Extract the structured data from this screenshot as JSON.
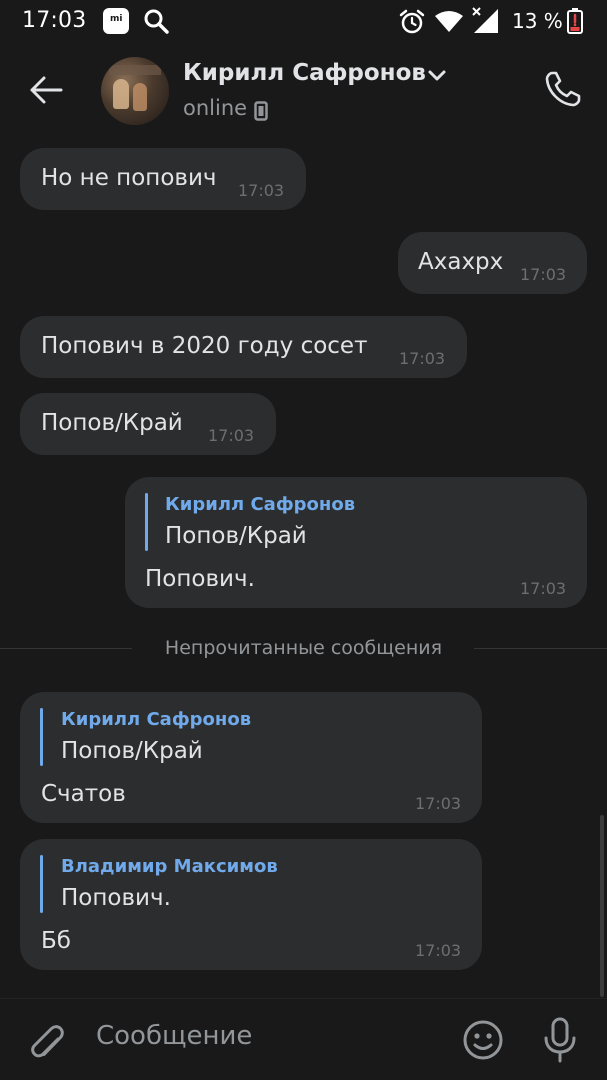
{
  "status_bar": {
    "time": "17:03",
    "mi_label": "mi",
    "battery": "13 %",
    "colors": {
      "battery_low": "#e64646"
    }
  },
  "header": {
    "name": "Кирилл Сафронов",
    "status": "online",
    "icons": {
      "back": "arrow-left-icon",
      "call": "phone-icon",
      "chevron": "chevron-down-icon",
      "device": "mobile-device-icon"
    }
  },
  "messages": [
    {
      "direction": "incoming",
      "text": "Но не попович",
      "time": "17:03"
    },
    {
      "direction": "outgoing",
      "text": "Ахахрх",
      "time": "17:03"
    },
    {
      "direction": "incoming",
      "text": "Попович в 2020 году сосет",
      "time": "17:03"
    },
    {
      "direction": "incoming",
      "text": "Попов/Край",
      "time": "17:03"
    },
    {
      "direction": "outgoing",
      "reply": {
        "author": "Кирилл Сафронов",
        "text": "Попов/Край"
      },
      "text": "Попович.",
      "time": "17:03"
    },
    {
      "direction": "incoming",
      "reply": {
        "author": "Кирилл Сафронов",
        "text": "Попов/Край"
      },
      "text": "Счатов",
      "time": "17:03"
    },
    {
      "direction": "incoming",
      "reply": {
        "author": "Владимир Максимов",
        "text": "Попович."
      },
      "text": "Бб",
      "time": "17:03"
    }
  ],
  "unread_divider": "Непрочитанные сообщения",
  "composer": {
    "placeholder": "Сообщение",
    "icons": {
      "attach": "paperclip-icon",
      "emoji": "emoji-icon",
      "mic": "microphone-icon"
    }
  },
  "colors": {
    "background": "#19191a",
    "bubble": "#2c2d2e",
    "accent": "#71aaeb",
    "text": "#e1e3e6",
    "secondary": "#939699"
  }
}
